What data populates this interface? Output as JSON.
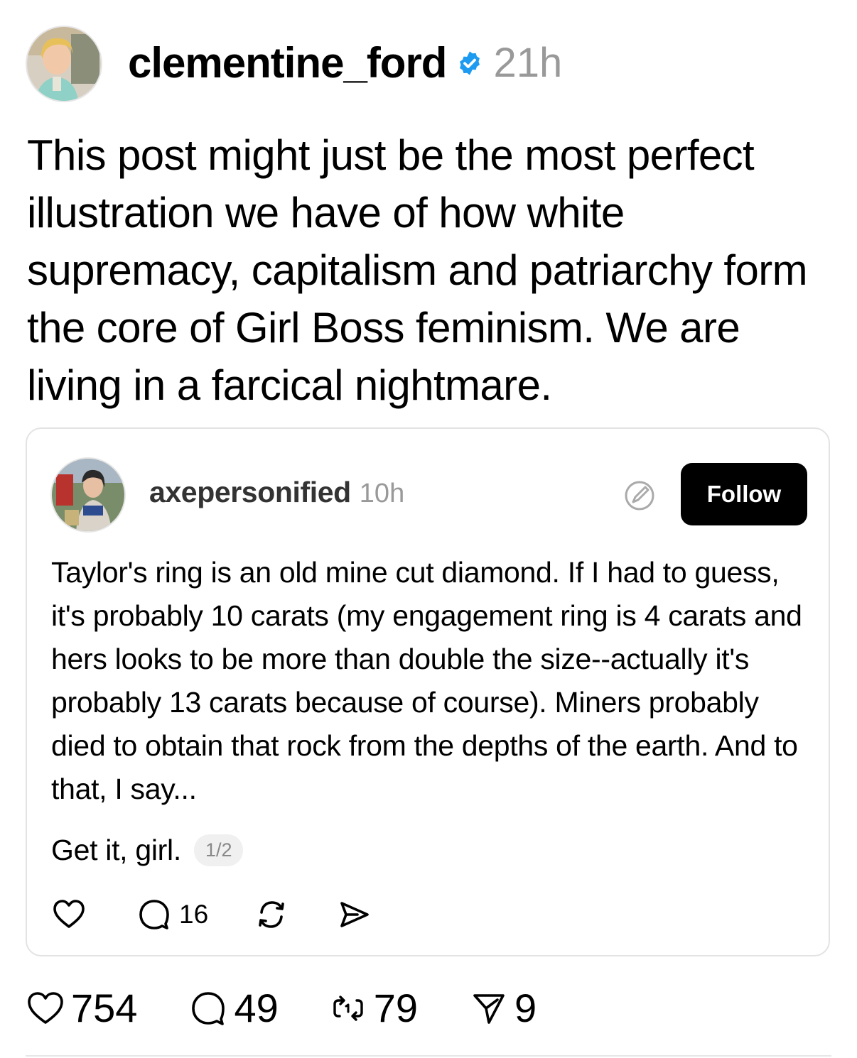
{
  "post": {
    "author": "clementine_ford",
    "time": "21h",
    "text": "This post might just be the most perfect illustration we have of how white supremacy, capitalism and patriarchy form the core of Girl Boss feminism. We are living in a farcical nightmare."
  },
  "quoted": {
    "author": "axepersonified",
    "time": "10h",
    "follow_label": "Follow",
    "text": "Taylor's ring is an old mine cut diamond. If I had to guess, it's probably 10 carats (my engagement ring is 4 carats and hers looks to be more than double the size--actually it's probably 13 carats because of course). Miners probably died to obtain that rock from the depths of the earth. And to that, I say...",
    "text_line2": "Get it, girl.",
    "page_indicator": "1/2",
    "reply_count": "16"
  },
  "actions": {
    "likes": "754",
    "replies": "49",
    "reposts": "79",
    "shares": "9"
  },
  "colors": {
    "verified": "#1d9bf0",
    "muted": "#999999",
    "border": "#e3e3e3"
  },
  "icons": [
    "verified-badge-icon",
    "quote-icon",
    "heart-icon",
    "comment-icon",
    "repost-icon",
    "share-icon"
  ]
}
